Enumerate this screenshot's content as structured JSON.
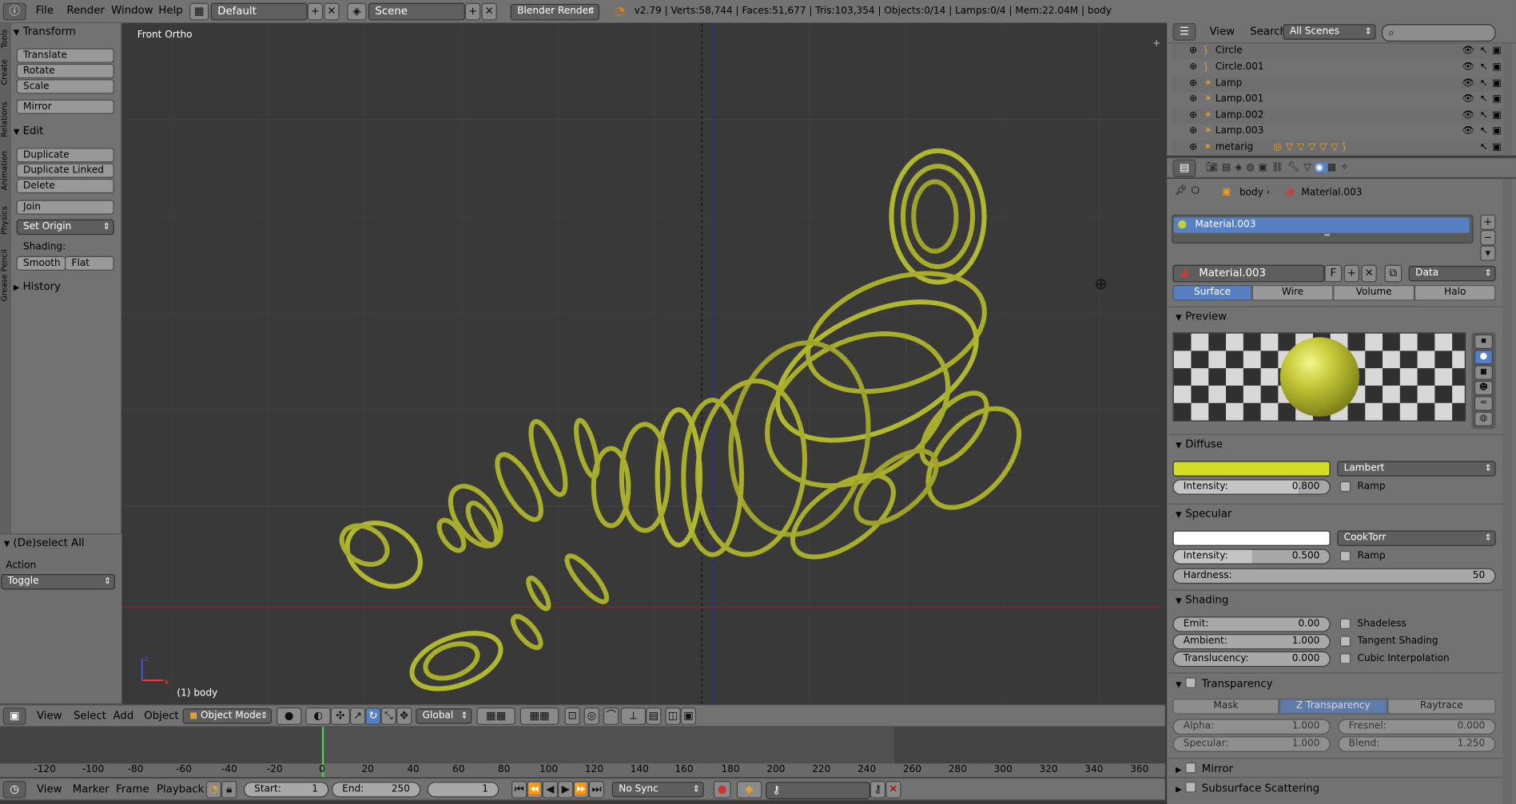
{
  "topbar": {
    "info_icon": "info-icon",
    "menus": [
      "File",
      "Render",
      "Window",
      "Help"
    ],
    "layout": "Default",
    "scene": "Scene",
    "engine": "Blender Render",
    "stats": "v2.79 | Verts:58,744 | Faces:51,677 | Tris:103,354 | Objects:0/14 | Lamps:0/4 | Mem:22.04M | body"
  },
  "tools": {
    "vtabs": [
      "Tools",
      "Create",
      "Relations",
      "Animation",
      "Physics",
      "Grease Pencil"
    ],
    "transform_header": "Transform",
    "translate": "Translate",
    "rotate": "Rotate",
    "scale": "Scale",
    "mirror": "Mirror",
    "edit_header": "Edit",
    "duplicate": "Duplicate",
    "duplicate_linked": "Duplicate Linked",
    "delete": "Delete",
    "join": "Join",
    "set_origin": "Set Origin",
    "shading_label": "Shading:",
    "smooth": "Smooth",
    "flat": "Flat",
    "history_header": "History",
    "deselect_header": "(De)select All",
    "action_label": "Action",
    "action_value": "Toggle"
  },
  "viewport": {
    "view_name": "Front Ortho",
    "object_label": "(1) body",
    "mesh_color": "#a8ad2c"
  },
  "viewheader": {
    "menus": [
      "View",
      "Select",
      "Add",
      "Object"
    ],
    "mode": "Object Mode",
    "orientation": "Global"
  },
  "timeline": {
    "ticks": [
      "-120",
      "-100",
      "-80",
      "-60",
      "-40",
      "-20",
      "0",
      "20",
      "40",
      "60",
      "80",
      "100",
      "120",
      "140",
      "160",
      "180",
      "200",
      "220",
      "240",
      "260",
      "280",
      "300",
      "320",
      "340",
      "360"
    ],
    "menus": [
      "View",
      "Marker",
      "Frame",
      "Playback"
    ],
    "start_label": "Start:",
    "start_value": "1",
    "end_label": "End:",
    "end_value": "250",
    "current_frame": "1",
    "sync": "No Sync"
  },
  "outliner": {
    "menus": [
      "View",
      "Search"
    ],
    "scenes": "All Scenes",
    "items": [
      "Circle",
      "Circle.001",
      "Lamp",
      "Lamp.001",
      "Lamp.002",
      "Lamp.003",
      "metarig"
    ]
  },
  "properties": {
    "breadcrumb_object": "body",
    "breadcrumb_material": "Material.003",
    "slot_name": "Material.003",
    "material_name": "Material.003",
    "fake_user": "F",
    "data_dd": "Data",
    "tabs": [
      "Surface",
      "Wire",
      "Volume",
      "Halo"
    ],
    "preview_header": "Preview",
    "diffuse_header": "Diffuse",
    "diffuse_color": "#d4dc28",
    "diffuse_shader": "Lambert",
    "diffuse_intensity_label": "Intensity:",
    "diffuse_intensity": "0.800",
    "diffuse_intensity_frac": 0.8,
    "ramp": "Ramp",
    "specular_header": "Specular",
    "specular_color": "#ffffff",
    "specular_shader": "CookTorr",
    "specular_intensity_label": "Intensity:",
    "specular_intensity": "0.500",
    "specular_intensity_frac": 0.5,
    "hardness_label": "Hardness:",
    "hardness": "50",
    "shading_header": "Shading",
    "emit_label": "Emit:",
    "emit": "0.00",
    "ambient_label": "Ambient:",
    "ambient": "1.000",
    "translucency_label": "Translucency:",
    "translucency": "0.000",
    "shadeless": "Shadeless",
    "tangent": "Tangent Shading",
    "cubic": "Cubic Interpolation",
    "transparency_header": "Transparency",
    "trans_tabs": [
      "Mask",
      "Z Transparency",
      "Raytrace"
    ],
    "alpha_label": "Alpha:",
    "alpha": "1.000",
    "fresnel_label": "Fresnel:",
    "fresnel": "0.000",
    "spec_label": "Specular:",
    "spec": "1.000",
    "blend_label": "Blend:",
    "blend": "1.250",
    "mirror_header": "Mirror",
    "sss_header": "Subsurface Scattering"
  }
}
